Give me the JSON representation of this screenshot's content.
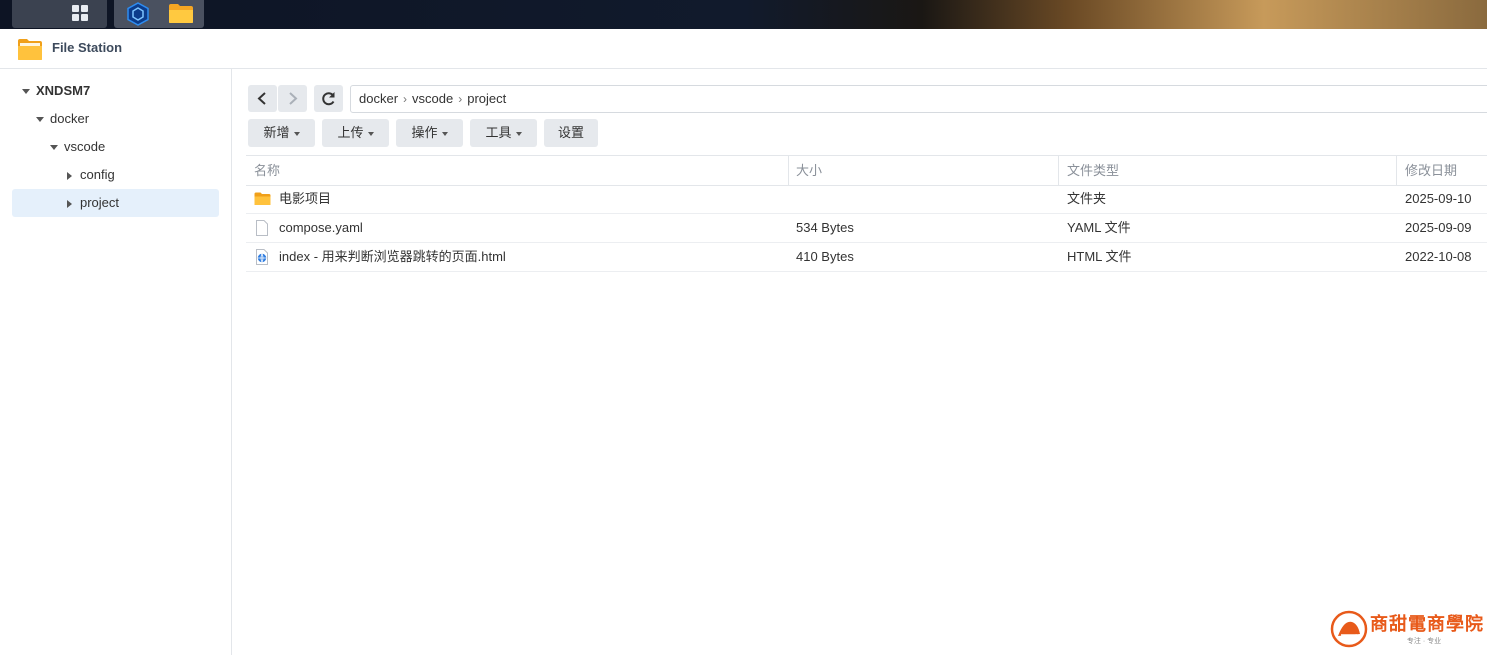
{
  "app": {
    "title": "File Station"
  },
  "sidebar": {
    "root": "XNDSM7",
    "items": [
      {
        "label": "docker"
      },
      {
        "label": "vscode"
      },
      {
        "label": "config"
      },
      {
        "label": "project"
      }
    ]
  },
  "path": {
    "crumbs": [
      "docker",
      "vscode",
      "project"
    ],
    "separator": "›"
  },
  "toolbar": {
    "create": "新增",
    "upload": "上传",
    "action": "操作",
    "tools": "工具",
    "settings": "设置"
  },
  "columns": {
    "name": "名称",
    "size": "大小",
    "type": "文件类型",
    "modified": "修改日期"
  },
  "files": [
    {
      "icon": "folder-icon",
      "name": "电影项目",
      "size": "",
      "type": "文件夹",
      "modified": "2025-09-10"
    },
    {
      "icon": "file-icon",
      "name": "compose.yaml",
      "size": "534 Bytes",
      "type": "YAML 文件",
      "modified": "2025-09-09"
    },
    {
      "icon": "html-file-icon",
      "name": "index - 用来判断浏览器跳转的页面.html",
      "size": "410 Bytes",
      "type": "HTML 文件",
      "modified": "2022-10-08"
    }
  ],
  "watermark": {
    "text": "商甜電商學院",
    "subtitle": "专注 · 专业"
  },
  "colors": {
    "accent": "#1e88e5",
    "selected_bg": "#e5f0fb",
    "folder": "#f8b62b",
    "watermark": "#e85a1a"
  }
}
